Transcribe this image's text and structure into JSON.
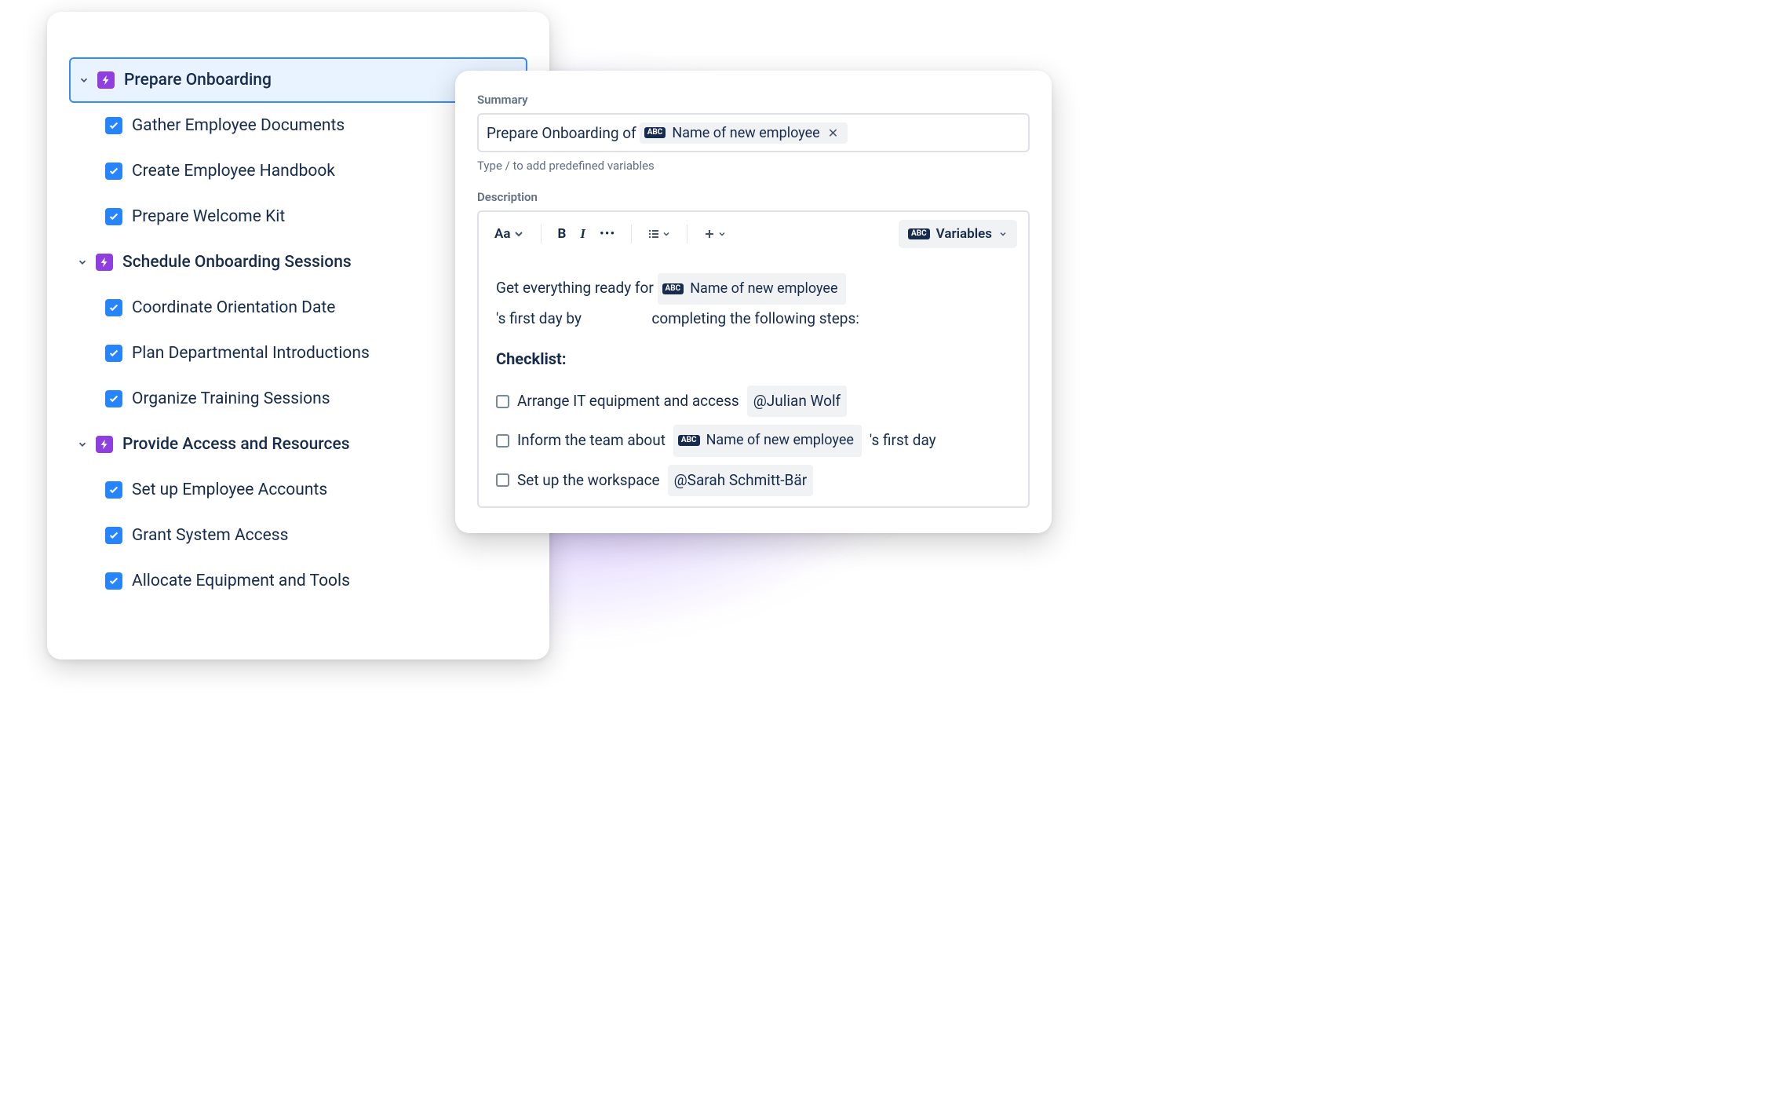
{
  "tree": {
    "groups": [
      {
        "label": "Prepare Onboarding",
        "selected": true,
        "children": [
          "Gather Employee Documents",
          "Create Employee Handbook",
          "Prepare Welcome Kit"
        ]
      },
      {
        "label": "Schedule Onboarding Sessions",
        "selected": false,
        "children": [
          "Coordinate Orientation Date",
          "Plan Departmental Introductions",
          "Organize Training Sessions"
        ]
      },
      {
        "label": "Provide Access and Resources",
        "selected": false,
        "children": [
          "Set up Employee Accounts",
          "Grant System Access",
          "Allocate Equipment and Tools"
        ]
      }
    ]
  },
  "summary": {
    "label": "Summary",
    "prefix": "Prepare Onboarding of",
    "variable": "Name of new employee",
    "hint": "Type / to add predefined variables"
  },
  "description": {
    "label": "Description",
    "toolbar": {
      "text_style": "Aa",
      "variables_btn": "Variables"
    },
    "body": {
      "line1_prefix": "Get everything ready for",
      "line1_var": "Name of new employee",
      "line2_a": "'s first day by",
      "line2_b": "completing the following steps:",
      "checklist_heading": "Checklist:",
      "items": [
        {
          "text": "Arrange IT equipment and access",
          "mention": "@Julian Wolf"
        },
        {
          "text_a": "Inform the team about",
          "var": "Name of new employee",
          "text_b": "'s first day"
        },
        {
          "text": "Set up the workspace",
          "mention": "@Sarah Schmitt-Bär"
        }
      ]
    }
  }
}
